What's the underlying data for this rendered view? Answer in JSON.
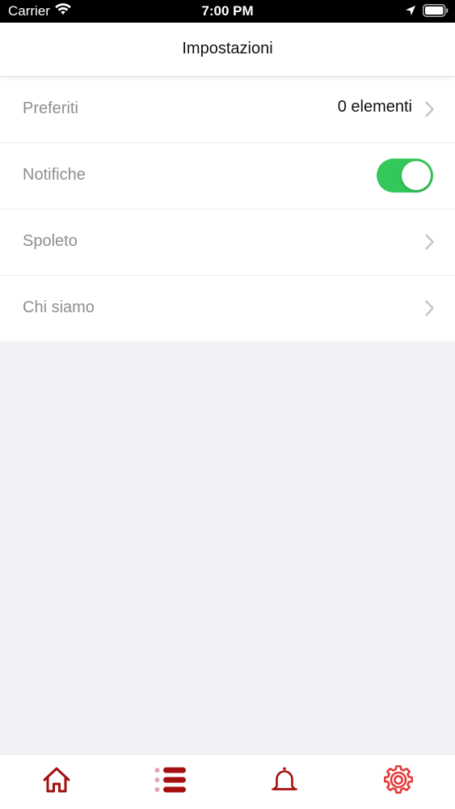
{
  "status_bar": {
    "carrier": "Carrier",
    "time": "7:00 PM"
  },
  "nav": {
    "title": "Impostazioni"
  },
  "settings": {
    "favorites": {
      "label": "Preferiti",
      "value": "0 elementi"
    },
    "notifications": {
      "label": "Notifiche",
      "enabled": true
    },
    "spoleto": {
      "label": "Spoleto"
    },
    "about": {
      "label": "Chi siamo"
    }
  },
  "tab_bar": {
    "tabs": [
      {
        "icon": "home-icon"
      },
      {
        "icon": "list-icon"
      },
      {
        "icon": "bell-icon"
      },
      {
        "icon": "gear-icon",
        "active": true
      }
    ]
  },
  "colors": {
    "accent": "#a50f0f",
    "accent_active": "#e53935",
    "toggle_on": "#34c759",
    "label_gray": "#8e8e93",
    "background": "#f2f1f6"
  }
}
